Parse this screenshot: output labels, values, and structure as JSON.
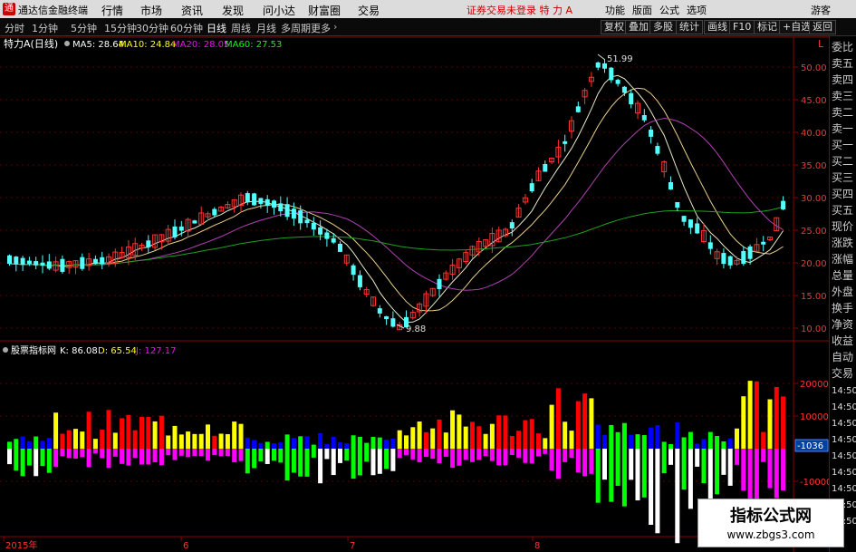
{
  "titlebar": {
    "app_name": "通达信金融终端",
    "menu": [
      "行情",
      "市场",
      "资讯",
      "发现",
      "问小达",
      "财富圈",
      "交易"
    ],
    "status": "证券交易未登录  特 力 A",
    "right_menu": [
      "功能",
      "版面",
      "公式",
      "选项"
    ],
    "user": "游客"
  },
  "toolbar": {
    "periods": [
      "分时",
      "1分钟",
      "5分钟",
      "15分钟",
      "30分钟",
      "60分钟",
      "日线",
      "周线",
      "月线",
      "多周期",
      "更多"
    ],
    "active_period": "日线",
    "right_buttons": [
      "复权",
      "叠加",
      "多股",
      "统计",
      "画线",
      "F10",
      "标记",
      "+自选",
      "返回"
    ]
  },
  "price_panel": {
    "stock": "特力A(日线)",
    "ma": [
      {
        "label": "MA5: 28.64",
        "color": "#ffffff"
      },
      {
        "label": "MA10: 24.84",
        "color": "#ffff00"
      },
      {
        "label": "MA20: 28.05",
        "color": "#ff00ff"
      },
      {
        "label": "MA60: 27.53",
        "color": "#00ff00"
      }
    ],
    "high_label": "51.99",
    "low_label": "9.88",
    "axis_ticks": [
      "50.00",
      "45.00",
      "40.00",
      "35.00",
      "30.00",
      "25.00",
      "20.00",
      "15.00",
      "10.00"
    ],
    "corner": "L"
  },
  "indicator_panel": {
    "name": "股票指标网",
    "k": "K: 86.08",
    "d": "D: 65.54",
    "j": "J: 127.17",
    "axis_ticks": [
      "20000",
      "10000",
      "-10000"
    ],
    "current_value": "-1036"
  },
  "x_axis": [
    "2015年",
    "6",
    "7",
    "8"
  ],
  "sidebar": {
    "items": [
      "委比",
      "卖五",
      "卖四",
      "卖三",
      "卖二",
      "卖一",
      "买一",
      "买二",
      "买三",
      "买四",
      "买五",
      "现价",
      "涨跌",
      "涨幅",
      "总量",
      "外盘",
      "换手",
      "净资",
      "收益",
      "自动",
      "交易"
    ],
    "times": [
      "14:50",
      "14:50",
      "14:50",
      "14:50",
      "14:50",
      "14:50",
      "14:50",
      "14:50",
      "14:50"
    ]
  },
  "watermark": {
    "title": "指标公式网",
    "url": "www.zbgs3.com"
  },
  "colors": {
    "up": "#ff3232",
    "down": "#54ffff",
    "ma5": "#ffffff",
    "ma10": "#ffff00",
    "ma20": "#ff00ff",
    "ma60": "#00ff00"
  }
}
